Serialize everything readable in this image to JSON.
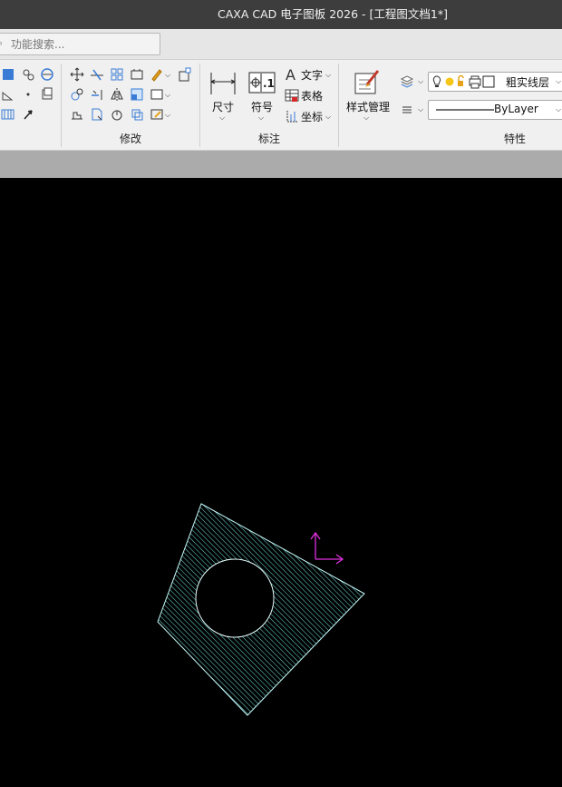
{
  "window": {
    "title": "CAXA CAD 电子图板 2026 - [工程图文档1*]"
  },
  "search": {
    "placeholder": "功能搜索..."
  },
  "ribbon": {
    "groups": {
      "modify": "修改",
      "annotate": "标注",
      "properties": "特性"
    },
    "annotate": {
      "dimension": "尺寸",
      "symbol": "符号",
      "text": "文字",
      "table": "表格",
      "coordinate": "坐标"
    },
    "style": {
      "label": "样式管理"
    },
    "properties": {
      "layer": "粗实线层",
      "linetype": "ByLayer"
    }
  },
  "colors": {
    "titlebar": "#3d3d3d",
    "ribbon": "#f0f0f0",
    "canvas": "#000000",
    "hatch": "#7ff4f4",
    "outline": "#c8fbfb",
    "ucs": "#e030e0"
  },
  "icons": {
    "modify": [
      "move-icon",
      "trim-icon",
      "array-icon",
      "stretch-icon",
      "pencil-icon",
      "scale-icon",
      "rotate-icon",
      "extend-icon",
      "mirror-icon",
      "fillet-icon",
      "block-icon",
      "offset-icon",
      "break-icon",
      "circle-arrow-icon",
      "explode-icon",
      "edit-icon"
    ],
    "left": [
      "line-icon",
      "polyline-icon",
      "circle-icon",
      "arc-icon",
      "point-icon",
      "rect-icon",
      "hatch-icon",
      "arrow-icon"
    ]
  }
}
